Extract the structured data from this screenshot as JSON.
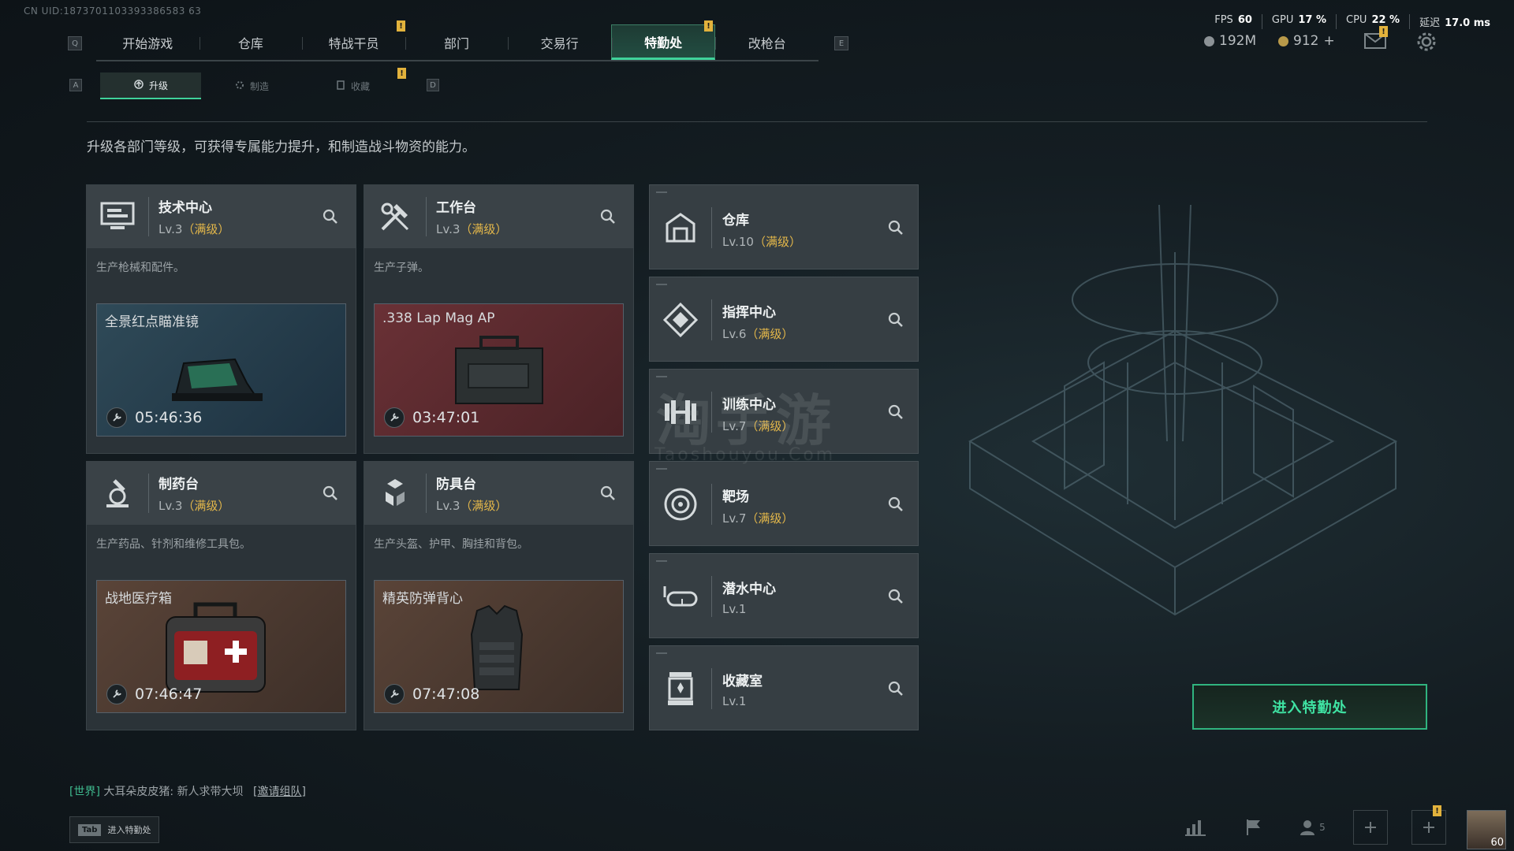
{
  "uid": "CN UID:1873701103393386583 63",
  "nav": {
    "left_key": "Q",
    "right_key": "E",
    "tabs": [
      {
        "label": "开始游戏"
      },
      {
        "label": "仓库"
      },
      {
        "label": "特战干员"
      },
      {
        "label": "部门"
      },
      {
        "label": "交易行"
      },
      {
        "label": "特勤处"
      },
      {
        "label": "改枪台"
      }
    ],
    "active_tab": "特勤处",
    "badge": "!"
  },
  "subnav": {
    "left_key": "A",
    "right_key": "D",
    "tabs": [
      {
        "label": "升级"
      },
      {
        "label": "制造"
      },
      {
        "label": "收藏"
      }
    ]
  },
  "status": {
    "fps_label": "FPS",
    "fps": "60",
    "gpu_label": "GPU",
    "gpu": "17 %",
    "cpu_label": "CPU",
    "cpu": "22 %",
    "latency_label": "延迟",
    "latency": "17.0 ms"
  },
  "currency": {
    "money": "192M",
    "coins": "912",
    "add": "+"
  },
  "description": "升级各部门等级，可获得专属能力提升，和制造战斗物资的能力。",
  "departments": [
    {
      "name": "技术中心",
      "level": "Lv.3",
      "max": "（满级）",
      "desc": "生产枪械和配件。",
      "craft_name": "全景红点瞄准镜",
      "timer": "05:46:36",
      "craft_color": "#2a4150"
    },
    {
      "name": "工作台",
      "level": "Lv.3",
      "max": "（满级）",
      "desc": "生产子弹。",
      "craft_name": ".338 Lap Mag AP",
      "timer": "03:47:01",
      "craft_color": "#5b2b2f"
    },
    {
      "name": "制药台",
      "level": "Lv.3",
      "max": "（满级）",
      "desc": "生产药品、针剂和维修工具包。",
      "craft_name": "战地医疗箱",
      "timer": "07:46:47",
      "craft_color": "#4a3b33"
    },
    {
      "name": "防具台",
      "level": "Lv.3",
      "max": "（满级）",
      "desc": "生产头盔、护甲、胸挂和背包。",
      "craft_name": "精英防弹背心",
      "timer": "07:47:08",
      "craft_color": "#4a3b33"
    }
  ],
  "facilities": [
    {
      "name": "仓库",
      "level": "Lv.10",
      "max": "（满级）"
    },
    {
      "name": "指挥中心",
      "level": "Lv.6",
      "max": "（满级）"
    },
    {
      "name": "训练中心",
      "level": "Lv.7",
      "max": "（满级）"
    },
    {
      "name": "靶场",
      "level": "Lv.7",
      "max": "（满级）"
    },
    {
      "name": "潜水中心",
      "level": "Lv.1",
      "max": ""
    },
    {
      "name": "收藏室",
      "level": "Lv.1",
      "max": ""
    }
  ],
  "enter_button": "进入特勤处",
  "chat": {
    "channel": "[世界]",
    "sender": "大耳朵皮皮猪:",
    "message": "新人求带大坝",
    "invite": "[邀请组队]"
  },
  "tab_hint": {
    "key": "Tab",
    "label": "进入特勤处"
  },
  "bottom": {
    "friends_count": "5",
    "player_level": "60"
  },
  "watermark": {
    "text": "淘手游",
    "sub": "Taoshouyou.Com"
  }
}
